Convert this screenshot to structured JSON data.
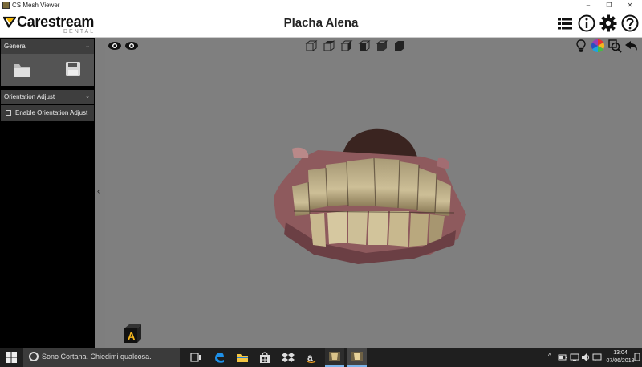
{
  "window": {
    "title": "CS Mesh Viewer",
    "minimize": "–",
    "restore": "❐",
    "close": "✕"
  },
  "header": {
    "logo_name": "Carestream",
    "logo_sub": "DENTAL",
    "document_title": "Placha Alena"
  },
  "sidebar": {
    "general_panel": {
      "title": "General",
      "chevron": "⌄"
    },
    "orientation_panel": {
      "title": "Orientation Adjust",
      "chevron": "⌄",
      "enable_label": "Enable Orientation Adjust",
      "enable_checked": false
    }
  },
  "collapse_arrow": "‹",
  "viewport": {
    "orientation_badge": "A",
    "background": "#7f7f7f"
  },
  "taskbar": {
    "search_placeholder": "Sono Cortana. Chiedimi qualcosa.",
    "time": "13:04",
    "date": "07/06/2018",
    "tray_chevron": "^"
  },
  "colors": {
    "sidebar_bg": "#000000",
    "panel_header": "#3e3e3e",
    "panel_body": "#545454",
    "viewport_bg": "#7f7f7f",
    "taskbar_bg": "#1f1f1f"
  }
}
